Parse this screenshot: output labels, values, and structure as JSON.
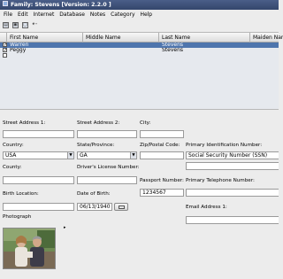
{
  "window": {
    "title": "Family: Stevens [Version: 2.2.0 ]"
  },
  "menu": [
    "File",
    "Edit",
    "Internet",
    "Database",
    "Notes",
    "Category",
    "Help"
  ],
  "toolbar_icons": [
    "print-icon",
    "save-icon",
    "note-icon",
    "back-arrow-icon"
  ],
  "grid": {
    "columns": [
      "First Name",
      "Middle Name",
      "Last Name",
      "Maiden Name"
    ],
    "rows": [
      {
        "checked": true,
        "first": "Warren",
        "middle": "",
        "last": "Stevens",
        "maiden": ""
      },
      {
        "checked": true,
        "first": "Peggy",
        "middle": "",
        "last": "Stevens",
        "maiden": ""
      }
    ]
  },
  "form": {
    "street1_label": "Street Address 1:",
    "street2_label": "Street Address 2:",
    "city_label": "City:",
    "country_label": "Country:",
    "country_value": "USA",
    "state_label": "State/Province:",
    "state_value": "GA",
    "zip_label": "Zip/Postal Code:",
    "primary_id_label": "Primary Identification Number:",
    "primary_id_value": "Social Security Number (SSN)",
    "county_label": "County:",
    "license_label": "Driver's License Number:",
    "passport_label": "Passport Number:",
    "passport_value": "1234567",
    "phone_label": "Primary Telephone Number:",
    "birth_location_label": "Birth Location:",
    "dob_label": "Date of Birth:",
    "dob_value": "06/13/1940",
    "email_label": "Email Address 1:",
    "photo_label": "Photograph",
    "photo_arrow": "▸"
  }
}
